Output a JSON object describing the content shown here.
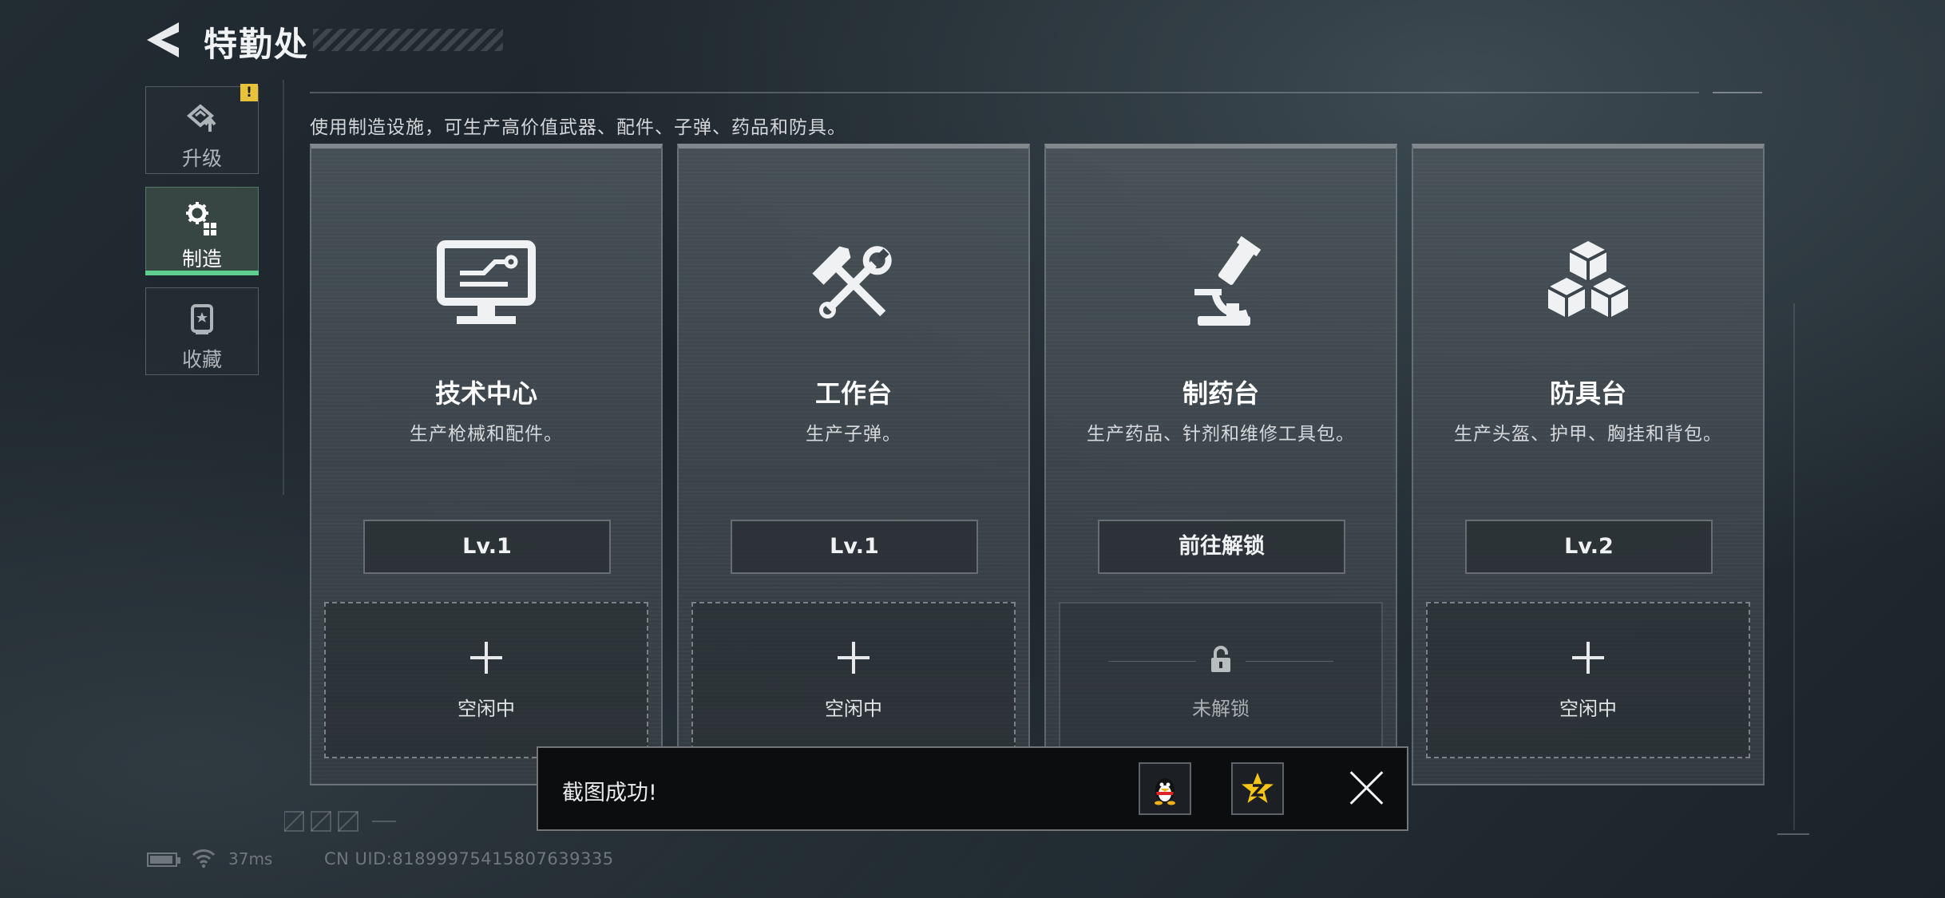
{
  "header": {
    "title": "特勤处"
  },
  "sidebar": {
    "items": [
      {
        "label": "升级",
        "icon": "upgrade-icon",
        "active": false,
        "badge": "!"
      },
      {
        "label": "制造",
        "icon": "gear-craft-icon",
        "active": true
      },
      {
        "label": "收藏",
        "icon": "collection-icon",
        "active": false
      }
    ]
  },
  "main": {
    "description": "使用制造设施，可生产高价值武器、配件、子弹、药品和防具。",
    "cards": [
      {
        "name": "技术中心",
        "desc": "生产枪械和配件。",
        "button": "Lv.1",
        "slot": "空闲中",
        "icon": "monitor-circuit-icon",
        "locked": false
      },
      {
        "name": "工作台",
        "desc": "生产子弹。",
        "button": "Lv.1",
        "slot": "空闲中",
        "icon": "hammer-wrench-icon",
        "locked": false
      },
      {
        "name": "制药台",
        "desc": "生产药品、针剂和维修工具包。",
        "button": "前往解锁",
        "slot": "未解锁",
        "icon": "microscope-icon",
        "locked": true
      },
      {
        "name": "防具台",
        "desc": "生产头盔、护甲、胸挂和背包。",
        "button": "Lv.2",
        "slot": "空闲中",
        "icon": "cubes-icon",
        "locked": false
      }
    ]
  },
  "toast": {
    "message": "截图成功!",
    "share_targets": [
      "qq-penguin-icon",
      "qzone-star-icon"
    ]
  },
  "status": {
    "ping": "37ms",
    "uid": "CN UID:81899975415807639335"
  },
  "colors": {
    "accent_green": "#5fcf8d",
    "warning_yellow": "#e8c238",
    "toast_bg": "#0b0d0f"
  }
}
